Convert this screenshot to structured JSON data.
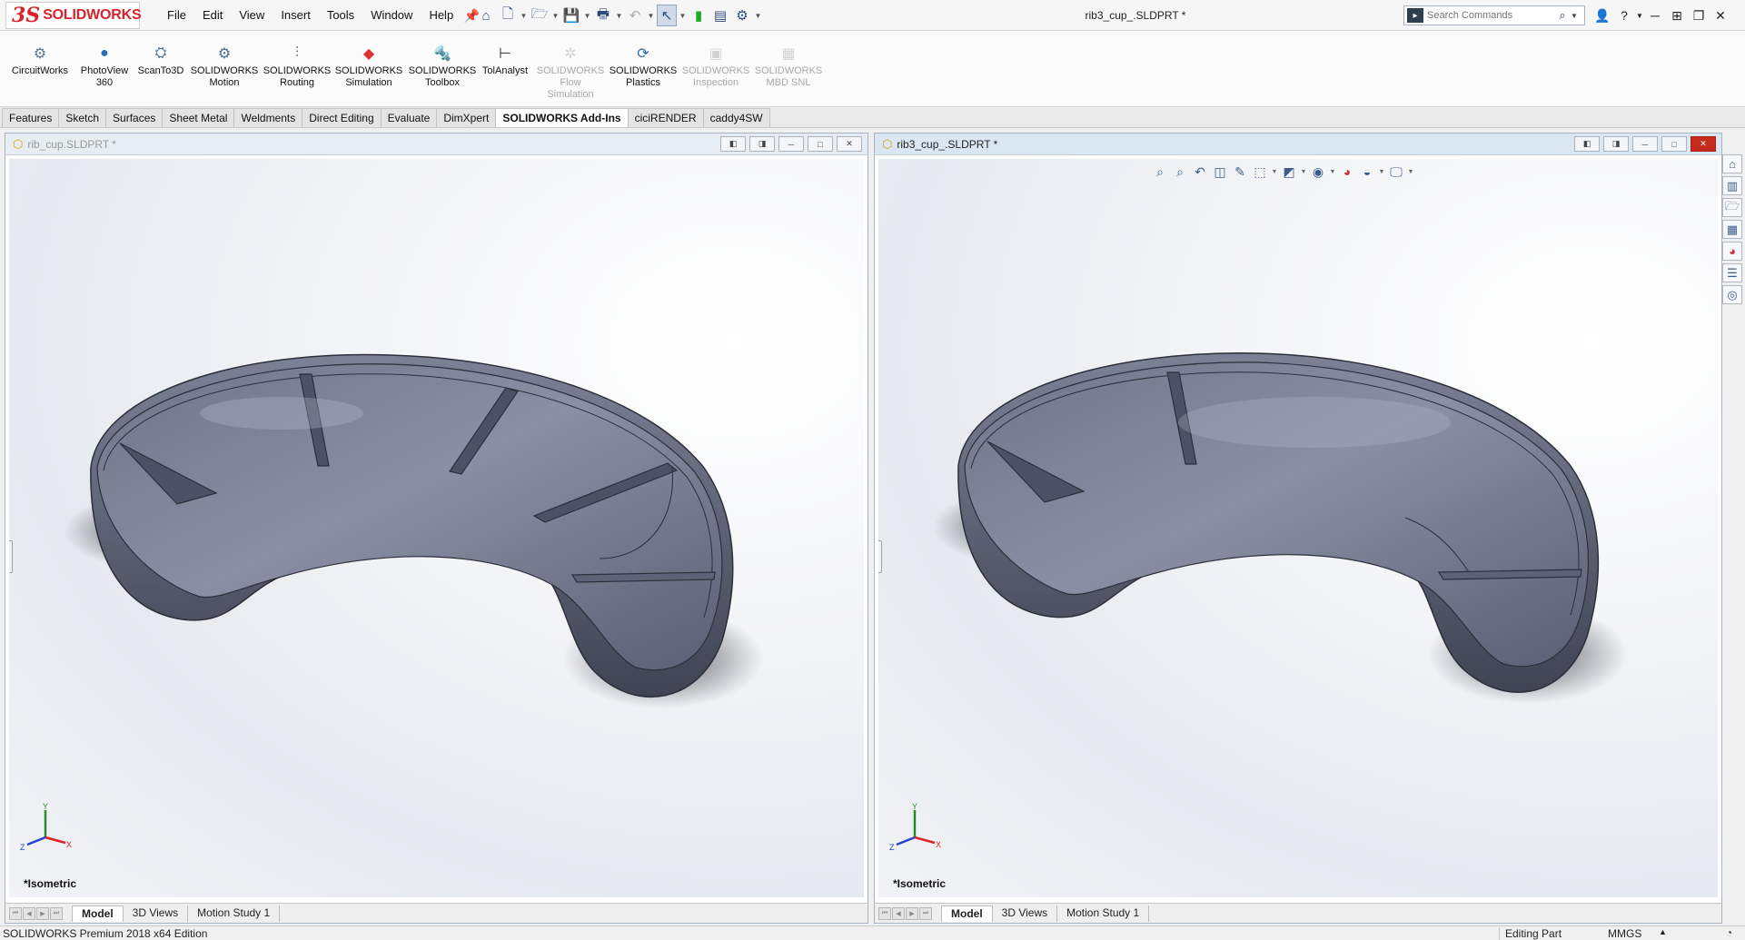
{
  "app": {
    "logo_ds": "3S",
    "logo_text": "SOLIDWORKS",
    "document_title": "rib3_cup_.SLDPRT *"
  },
  "menu": {
    "items": [
      "File",
      "Edit",
      "View",
      "Insert",
      "Tools",
      "Window",
      "Help"
    ]
  },
  "search": {
    "placeholder": "Search Commands"
  },
  "ribbon": {
    "buttons": [
      {
        "label": "CircuitWorks",
        "icon": "circuitworks-icon",
        "enabled": true
      },
      {
        "label": "PhotoView\n360",
        "icon": "photoview-icon",
        "enabled": true
      },
      {
        "label": "ScanTo3D",
        "icon": "scanto3d-icon",
        "enabled": true
      },
      {
        "label": "SOLIDWORKS\nMotion",
        "icon": "motion-icon",
        "enabled": true
      },
      {
        "label": "SOLIDWORKS\nRouting",
        "icon": "routing-icon",
        "enabled": true
      },
      {
        "label": "SOLIDWORKS\nSimulation",
        "icon": "simulation-icon",
        "enabled": true
      },
      {
        "label": "SOLIDWORKS\nToolbox",
        "icon": "toolbox-icon",
        "enabled": true
      },
      {
        "label": "TolAnalyst",
        "icon": "tolanalyst-icon",
        "enabled": true
      },
      {
        "label": "SOLIDWORKS\nFlow\nSimulation",
        "icon": "flow-simulation-icon",
        "enabled": false
      },
      {
        "label": "SOLIDWORKS\nPlastics",
        "icon": "plastics-icon",
        "enabled": true
      },
      {
        "label": "SOLIDWORKS\nInspection",
        "icon": "inspection-icon",
        "enabled": false
      },
      {
        "label": "SOLIDWORKS\nMBD SNL",
        "icon": "mbd-snl-icon",
        "enabled": false
      }
    ]
  },
  "tabs": {
    "items": [
      {
        "label": "Features",
        "active": false
      },
      {
        "label": "Sketch",
        "active": false
      },
      {
        "label": "Surfaces",
        "active": false
      },
      {
        "label": "Sheet Metal",
        "active": false
      },
      {
        "label": "Weldments",
        "active": false
      },
      {
        "label": "Direct Editing",
        "active": false
      },
      {
        "label": "Evaluate",
        "active": false
      },
      {
        "label": "DimXpert",
        "active": false
      },
      {
        "label": "SOLIDWORKS Add-Ins",
        "active": true
      },
      {
        "label": "ciciRENDER",
        "active": false
      },
      {
        "label": "caddy4SW",
        "active": false
      }
    ]
  },
  "windows": {
    "left": {
      "title": "rib_cup.SLDPRT *",
      "view_name": "*Isometric",
      "bottom_tabs": [
        "Model",
        "3D Views",
        "Motion Study 1"
      ],
      "active_tab": "Model"
    },
    "right": {
      "title": "rib3_cup_.SLDPRT *",
      "view_name": "*Isometric",
      "bottom_tabs": [
        "Model",
        "3D Views",
        "Motion Study 1"
      ],
      "active_tab": "Model"
    }
  },
  "triad": {
    "x": "X",
    "y": "Y",
    "z": "Z"
  },
  "status": {
    "edition": "SOLIDWORKS Premium 2018 x64 Edition",
    "mode": "Editing Part",
    "units": "MMGS"
  },
  "colors": {
    "model_fill": "#7b8096",
    "model_dark": "#4e5366",
    "model_light": "#a6aabb",
    "accent_red": "#d8232a"
  }
}
